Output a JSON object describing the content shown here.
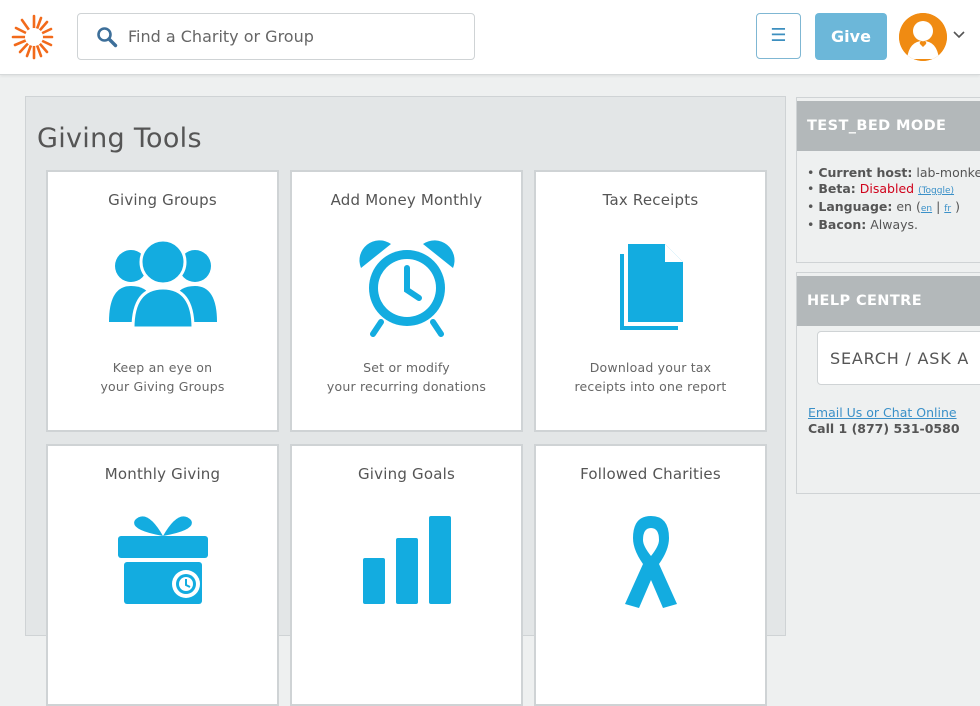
{
  "header": {
    "search_placeholder": "Find a Charity or Group",
    "menu_glyph": "☰",
    "give_label": "Give",
    "icons": [
      "search-icon",
      "menu-icon",
      "user-avatar-icon",
      "chevron-down-icon"
    ]
  },
  "tools": {
    "title": "Giving Tools",
    "cards": [
      {
        "title": "Giving Groups",
        "desc1": "Keep an eye on",
        "desc2": "your Giving Groups",
        "icon": "group-icon"
      },
      {
        "title": "Add Money Monthly",
        "desc1": "Set or modify",
        "desc2": "your recurring donations",
        "icon": "alarm-clock-icon"
      },
      {
        "title": "Tax Receipts",
        "desc1": "Download your tax",
        "desc2": "receipts into one report",
        "icon": "document-icon"
      },
      {
        "title": "Monthly Giving",
        "desc1": "",
        "desc2": "",
        "icon": "gift-clock-icon"
      },
      {
        "title": "Giving Goals",
        "desc1": "",
        "desc2": "",
        "icon": "bar-chart-icon"
      },
      {
        "title": "Followed Charities",
        "desc1": "",
        "desc2": "",
        "icon": "ribbon-icon"
      }
    ]
  },
  "testbed": {
    "title": "TEST_BED MODE",
    "host_label": "Current host:",
    "host_value": "lab-monkey",
    "beta_label": "Beta:",
    "beta_value": "Disabled",
    "toggle_label": "(Toggle)",
    "language_label": "Language:",
    "language_value": "en",
    "lang_en": "en",
    "lang_fr": "fr",
    "bacon_label": "Bacon:",
    "bacon_value": "Always."
  },
  "help": {
    "title": "HELP CENTRE",
    "search_placeholder": "SEARCH / ASK A",
    "link": "Email Us or Chat Online",
    "phone": "Call 1 (877) 531-0580"
  },
  "colors": {
    "accent_blue": "#13ace0",
    "give_button": "#6cb7d9",
    "logo_orange": "#f26a1b",
    "beta_red": "#d0021b"
  }
}
